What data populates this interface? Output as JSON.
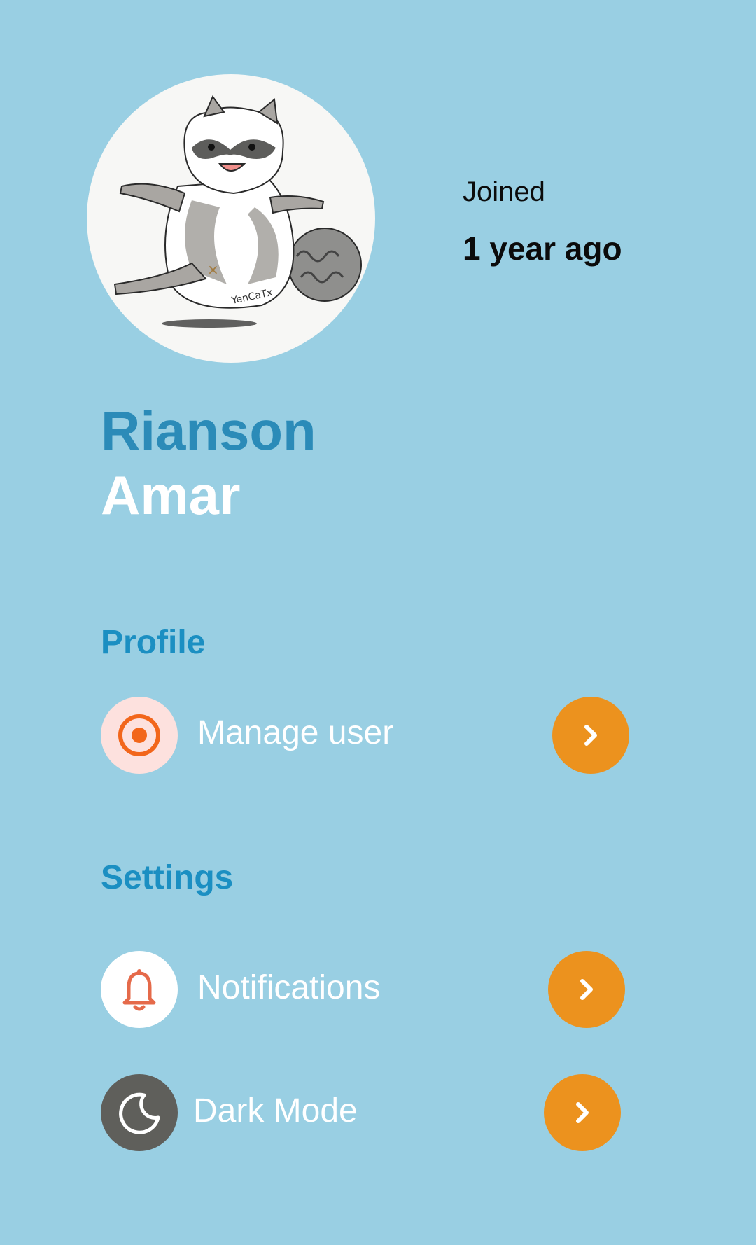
{
  "profile": {
    "joined_label": "Joined",
    "joined_value": "1 year ago",
    "first_name": "Rianson",
    "last_name": "Amar",
    "avatar_icon": "raccoon-illustration"
  },
  "sections": {
    "profile": {
      "title": "Profile",
      "items": [
        {
          "label": "Manage user",
          "icon": "target-icon"
        }
      ]
    },
    "settings": {
      "title": "Settings",
      "items": [
        {
          "label": "Notifications",
          "icon": "bell-icon"
        },
        {
          "label": "Dark Mode",
          "icon": "moon-icon"
        }
      ]
    }
  },
  "colors": {
    "background": "#99cfe3",
    "accent_orange": "#ec921e",
    "name_blue": "#2b8bb8",
    "section_blue": "#1b8fc2"
  }
}
